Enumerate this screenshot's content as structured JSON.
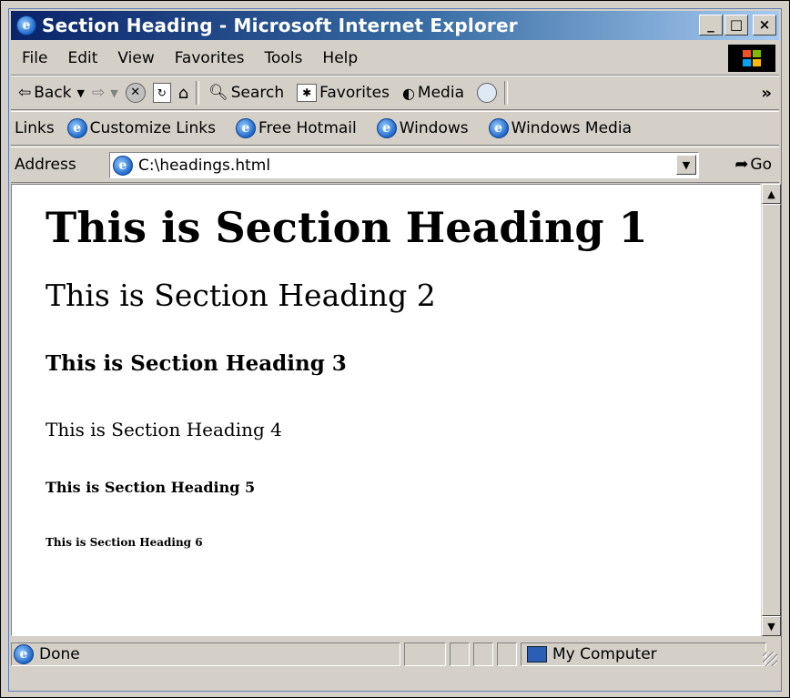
{
  "window": {
    "title": "Section Heading - Microsoft Internet Explorer",
    "minimize": "_",
    "maximize": "□",
    "close": "×"
  },
  "menu": [
    "File",
    "Edit",
    "View",
    "Favorites",
    "Tools",
    "Help"
  ],
  "toolbar": {
    "back": "Back",
    "search": "Search",
    "favorites": "Favorites",
    "media": "Media",
    "more": "»"
  },
  "links": {
    "label": "Links",
    "items": [
      "Customize Links",
      "Free Hotmail",
      "Windows",
      "Windows Media"
    ]
  },
  "address": {
    "label": "Address",
    "value": "C:\\headings.html",
    "go": "Go"
  },
  "page": {
    "h1": "This is Section Heading 1",
    "h2": "This is Section Heading 2",
    "h3": "This is Section Heading 3",
    "h4": "This is Section Heading 4",
    "h5": "This is Section Heading 5",
    "h6": "This is Section Heading 6"
  },
  "status": {
    "text": "Done",
    "zone": "My Computer"
  }
}
